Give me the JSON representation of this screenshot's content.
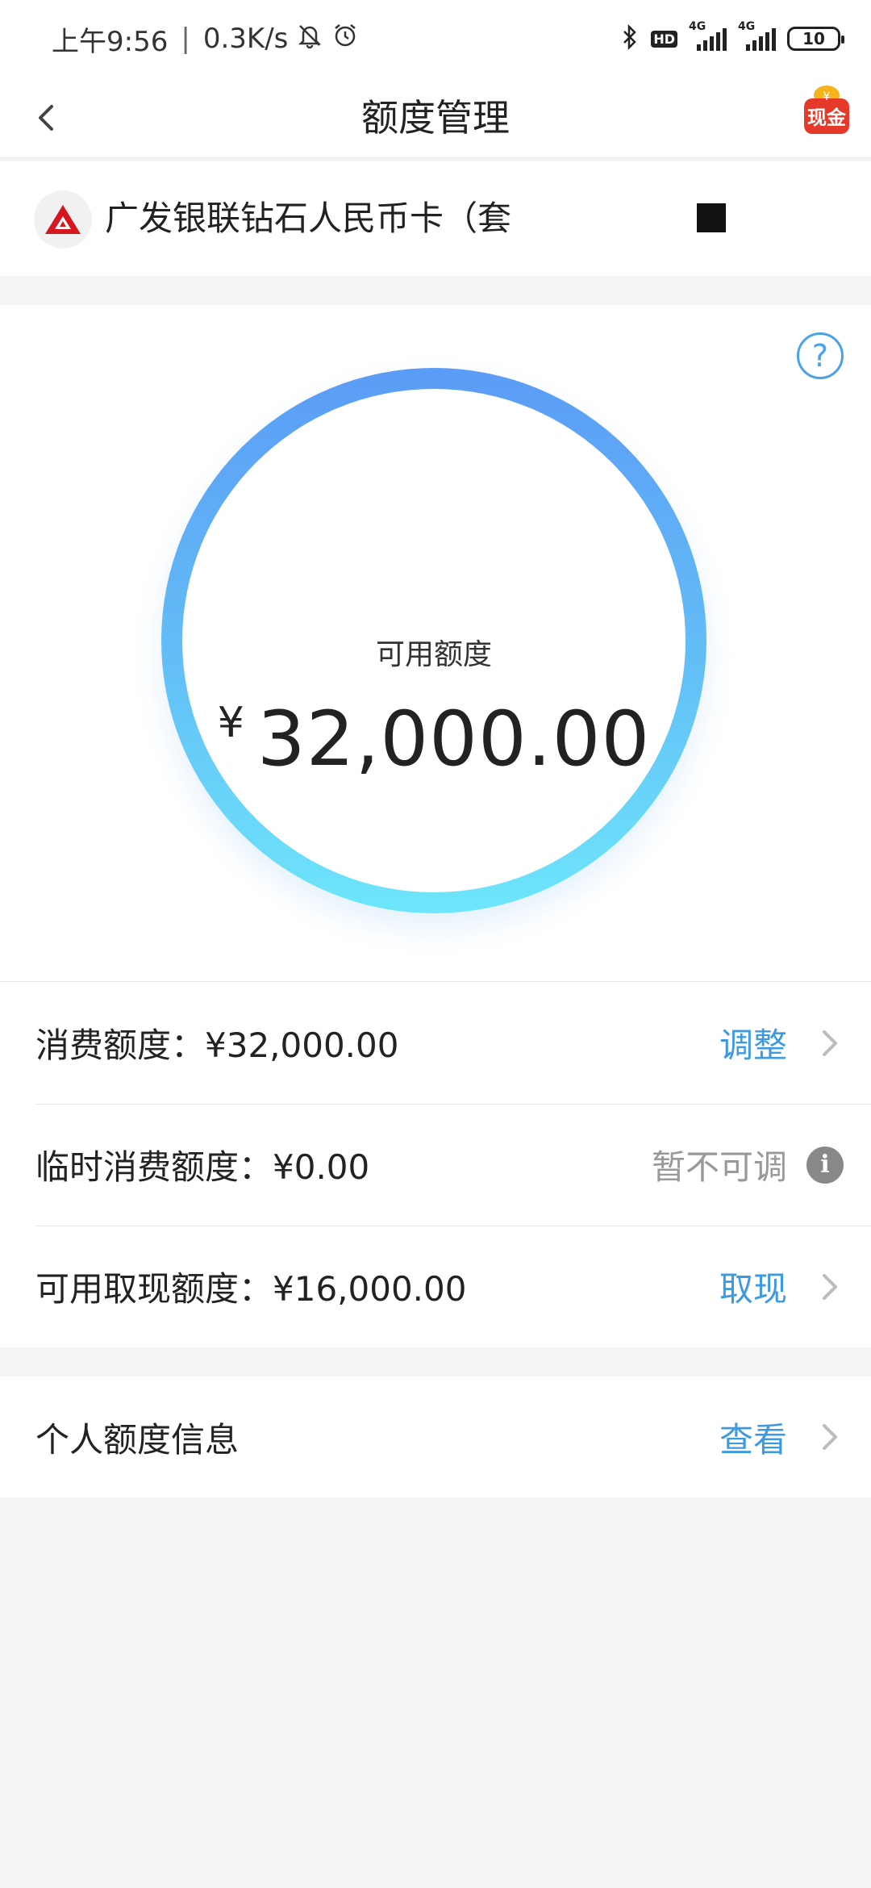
{
  "status_bar": {
    "time": "上午9:56",
    "network_speed": "0.3K/s",
    "signal_tag_1": "4G",
    "signal_tag_2": "4G",
    "hd_label": "HD",
    "battery": "10"
  },
  "header": {
    "title": "额度管理",
    "cash_badge_label": "现金",
    "cash_badge_symbol": "¥"
  },
  "card": {
    "name": "广发银联钻石人民币卡（套"
  },
  "summary": {
    "label": "可用额度",
    "currency": "¥",
    "amount": "32,000.00",
    "help_symbol": "?"
  },
  "rows": [
    {
      "label": "消费额度：¥32,000.00",
      "action": "调整"
    },
    {
      "label": "临时消费额度：¥0.00",
      "action": "暂不可调",
      "info_symbol": "i"
    },
    {
      "label": "可用取现额度：¥16,000.00",
      "action": "取现"
    }
  ],
  "personal": {
    "label": "个人额度信息",
    "action": "查看"
  },
  "colors": {
    "accent_blue": "#3d9ae0",
    "ring_top": "#5b9cf6",
    "ring_bottom": "#6ee6fb",
    "bank_red": "#d6171e"
  }
}
